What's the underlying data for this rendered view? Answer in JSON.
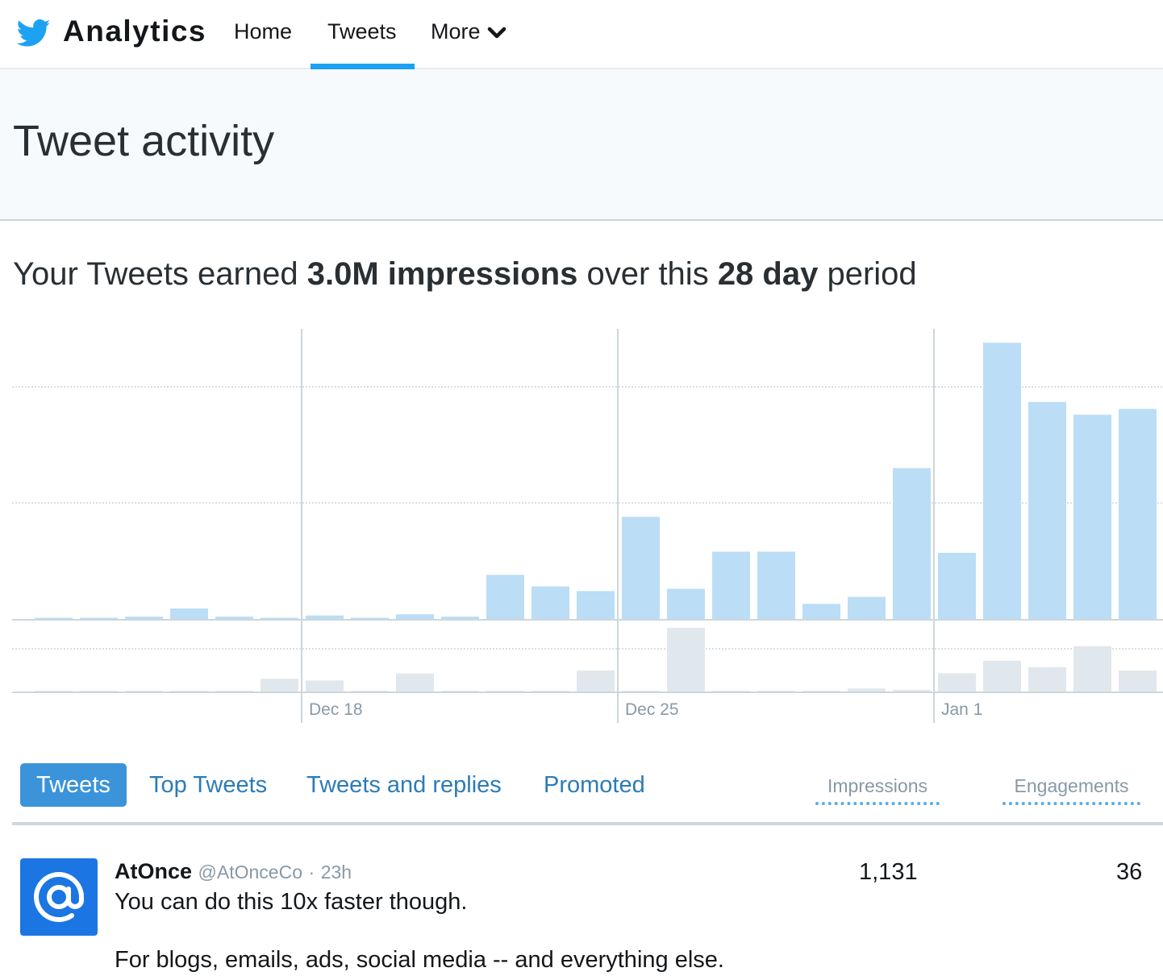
{
  "nav": {
    "brand": "Analytics",
    "logo_icon": "twitter-bird-icon",
    "links": [
      {
        "label": "Home",
        "active": false
      },
      {
        "label": "Tweets",
        "active": true
      },
      {
        "label": "More",
        "active": false,
        "icon": "chevron-down-icon"
      }
    ],
    "accent_color": "#1da1f2"
  },
  "header": {
    "title": "Tweet activity"
  },
  "summary": {
    "prefix": "Your Tweets earned ",
    "impressions": "3.0M impressions",
    "middle": " over this ",
    "period": "28 day",
    "suffix": " period"
  },
  "chart_data": {
    "type": "bar",
    "title": "",
    "xlabel": "",
    "ylabel": "",
    "x_tick_labels": [
      "Dec 18",
      "Dec 25",
      "Jan 1"
    ],
    "x_tick_positions_day_index": [
      6,
      13,
      20
    ],
    "grid": true,
    "legend": "none",
    "series": [
      {
        "name": "Impressions",
        "color": "#bbddf5",
        "unit": "gridline-units",
        "ylim": [
          0,
          2.5
        ],
        "gridlines": [
          1,
          2
        ],
        "values": [
          0.01,
          0.01,
          0.02,
          0.09,
          0.02,
          0.01,
          0.03,
          0.01,
          0.04,
          0.02,
          0.38,
          0.28,
          0.24,
          0.88,
          0.26,
          0.58,
          0.58,
          0.13,
          0.19,
          1.3,
          0.57,
          2.38,
          1.87,
          1.76,
          1.81
        ]
      },
      {
        "name": "Engagements",
        "color": "#e1e8ed",
        "unit": "gridline-units",
        "ylim": [
          0,
          1.0
        ],
        "gridlines": [
          1
        ],
        "values": [
          0.02,
          0.02,
          0.02,
          0.02,
          0.02,
          0.3,
          0.26,
          0.02,
          0.42,
          0.02,
          0.02,
          0.02,
          0.49,
          0.01,
          1.49,
          0.02,
          0.01,
          0.01,
          0.07,
          0.04,
          0.43,
          0.72,
          0.57,
          1.06,
          0.49
        ]
      }
    ]
  },
  "tabs": [
    {
      "label": "Tweets",
      "active": true
    },
    {
      "label": "Top Tweets",
      "active": false
    },
    {
      "label": "Tweets and replies",
      "active": false
    },
    {
      "label": "Promoted",
      "active": false
    }
  ],
  "columns": {
    "impressions": "Impressions",
    "engagements": "Engagements"
  },
  "tweets": [
    {
      "avatar_icon": "at-sign-icon",
      "name": "AtOnce",
      "handle": "@AtOnceCo",
      "separator": "·",
      "time": "23h",
      "text_line1": "You can do this 10x faster though.",
      "text_line2": "For blogs, emails, ads, social media -- and everything else.",
      "impressions": "1,131",
      "engagements": "36"
    }
  ]
}
